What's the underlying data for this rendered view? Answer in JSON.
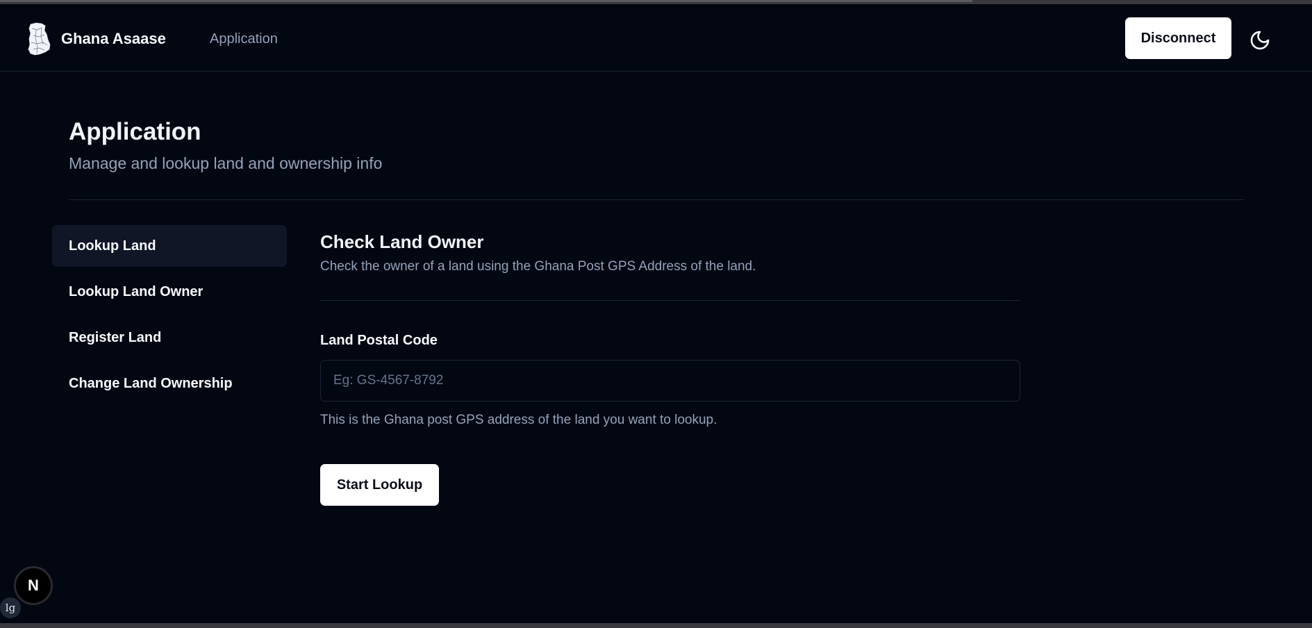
{
  "header": {
    "brand_name": "Ghana Asaase",
    "nav_link": "Application",
    "disconnect_label": "Disconnect",
    "theme_icon": "moon-icon"
  },
  "page": {
    "title": "Application",
    "subtitle": "Manage and lookup land and ownership info"
  },
  "sidebar": {
    "items": [
      {
        "label": "Lookup Land",
        "active": true
      },
      {
        "label": "Lookup Land Owner",
        "active": false
      },
      {
        "label": "Register Land",
        "active": false
      },
      {
        "label": "Change Land Ownership",
        "active": false
      }
    ]
  },
  "panel": {
    "title": "Check Land Owner",
    "description": "Check the owner of a land using the Ghana Post GPS Address of the land.",
    "field_label": "Land Postal Code",
    "field_value": "",
    "field_placeholder": "Eg: GS-4567-8792",
    "field_help": "This is the Ghana post GPS address of the land you want to lookup.",
    "submit_label": "Start Lookup"
  },
  "dev": {
    "badge_letter": "N",
    "breakpoint": "lg"
  },
  "colors": {
    "background": "#030712",
    "active_item": "#111627",
    "muted_text": "#94a3b8",
    "button_bg": "#ffffff"
  }
}
